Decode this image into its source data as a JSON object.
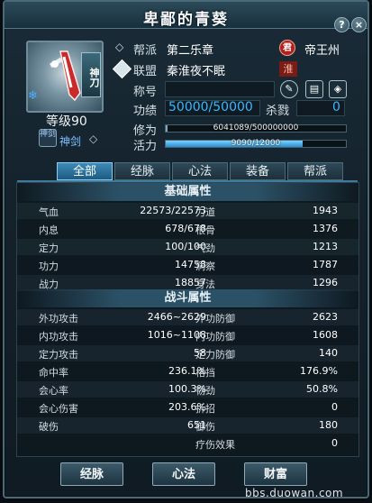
{
  "window": {
    "title": "卑鄙的青葵",
    "help_label": "?",
    "close_label": "×"
  },
  "profile": {
    "class_tag": "神刀",
    "level_text": "等级90",
    "sect_icon_text": "神剑",
    "sect_name": "神剑"
  },
  "info": {
    "guild_label": "帮派",
    "guild_value": "第二乐章",
    "league_label": "联盟",
    "league_value": "秦淮夜不眠",
    "server_seal": "君",
    "server_name": "帝王州",
    "league_tag": "淮",
    "title_label": "称号",
    "title_value": "",
    "achievement_label": "功绩",
    "achievement_value": "50000/50000",
    "kills_label": "杀戮",
    "kills_value": "0"
  },
  "bars": {
    "cultivation_label": "修为",
    "cultivation_text": "6041089/500000000",
    "cultivation_fraction": 0.012,
    "vitality_label": "活力",
    "vitality_text": "9090/12000",
    "vitality_fraction": 0.7575
  },
  "tabs": [
    "全部",
    "经脉",
    "心法",
    "装备",
    "帮派"
  ],
  "basic": {
    "title": "基础属性",
    "rows": [
      [
        "气血",
        "22573/22573",
        "力道",
        "1943"
      ],
      [
        "内息",
        "678/678",
        "根骨",
        "1376"
      ],
      [
        "定力",
        "100/100",
        "气劲",
        "1213"
      ],
      [
        "功力",
        "14758",
        "洞察",
        "1787"
      ],
      [
        "战力",
        "18857",
        "身法",
        "1296"
      ]
    ]
  },
  "combat": {
    "title": "战斗属性",
    "rows": [
      [
        "外功攻击",
        "2466~2629",
        "外功防御",
        "2623"
      ],
      [
        "内功攻击",
        "1016~1108",
        "内功防御",
        "1608"
      ],
      [
        "定力攻击",
        "58",
        "定力防御",
        "140"
      ],
      [
        "命中率",
        "236.1%",
        "格挡",
        "176.9%"
      ],
      [
        "会心率",
        "100.3%",
        "韧劲",
        "50.8%"
      ],
      [
        "会心伤害",
        "203.6%",
        "拆招",
        "0"
      ],
      [
        "破伤",
        "651",
        "御伤",
        "180"
      ],
      [
        "",
        "",
        "疗伤效果",
        "0"
      ]
    ]
  },
  "buttons": {
    "meridians": "经脉",
    "heart_method": "心法",
    "wealth": "财富"
  },
  "watermark": "bbs.duowan.com"
}
